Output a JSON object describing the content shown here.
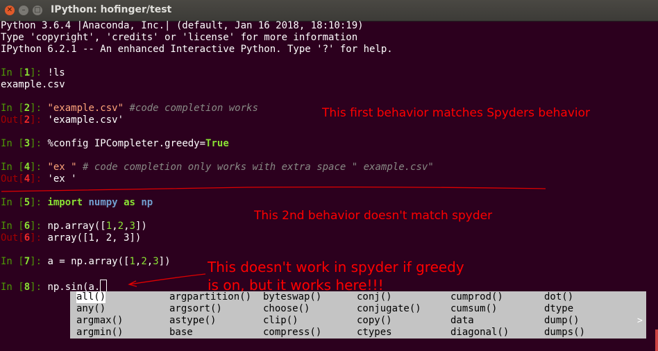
{
  "window": {
    "title": "IPython: hofinger/test",
    "close": "✕",
    "minimize": "–",
    "maximize": "□"
  },
  "banner": [
    "Python 3.6.4 |Anaconda, Inc.| (default, Jan 16 2018, 18:10:19)",
    "Type 'copyright', 'credits' or 'license' for more information",
    "IPython 6.2.1 -- An enhanced Interactive Python. Type '?' for help."
  ],
  "cells": {
    "in1": {
      "n": "1",
      "code": "!ls"
    },
    "out1_text": "example.csv",
    "in2": {
      "n": "2",
      "str": "\"example.csv\"",
      "comment": "#code completion works"
    },
    "out2": {
      "n": "2",
      "text": "'example.csv'"
    },
    "in3": {
      "n": "3",
      "pre": "%config IPCompleter.greedy=",
      "val": "True"
    },
    "in4": {
      "n": "4",
      "str": "\"ex \"",
      "comment": "# code completion only works with extra space \" example.csv\""
    },
    "out4": {
      "n": "4",
      "text": "'ex '"
    },
    "in5": {
      "n": "5",
      "kw1": "import",
      "mod": "numpy",
      "kw2": "as",
      "alias": "np"
    },
    "in6": {
      "n": "6",
      "pre": "np.array([",
      "a": "1",
      "b": "2",
      "c": "3",
      "post": "])"
    },
    "out6": {
      "n": "6",
      "text": "array([1, 2, 3])"
    },
    "in7": {
      "n": "7",
      "pre": "a = np.array([",
      "a": "1",
      "b": "2",
      "c": "3",
      "post": "])"
    },
    "in8": {
      "n": "8",
      "code": "np.sin(a."
    }
  },
  "annotations": {
    "note1": "This first behavior matches Spyders behavior",
    "note2": "This 2nd behavior doesn't match spyder",
    "note3_line1": "This doesn't work in spyder if greedy",
    "note3_line2": "is on, but it works here!!!"
  },
  "completions": [
    [
      "all()",
      "any()",
      "argmax()",
      "argmin()"
    ],
    [
      "argpartition()",
      "argsort()",
      "astype()",
      "base"
    ],
    [
      "byteswap()",
      "choose()",
      "clip()",
      "compress()"
    ],
    [
      "conj()",
      "conjugate()",
      "copy()",
      "ctypes"
    ],
    [
      "cumprod()",
      "cumsum()",
      "data",
      "diagonal()"
    ],
    [
      "dot()",
      "dtype",
      "dump()",
      "dumps()"
    ]
  ],
  "popup_more": ">",
  "colors": {
    "background": "#2c001e",
    "annotation": "#ff0000",
    "prompt_in": "#4e9a06",
    "prompt_out": "#a40000"
  }
}
